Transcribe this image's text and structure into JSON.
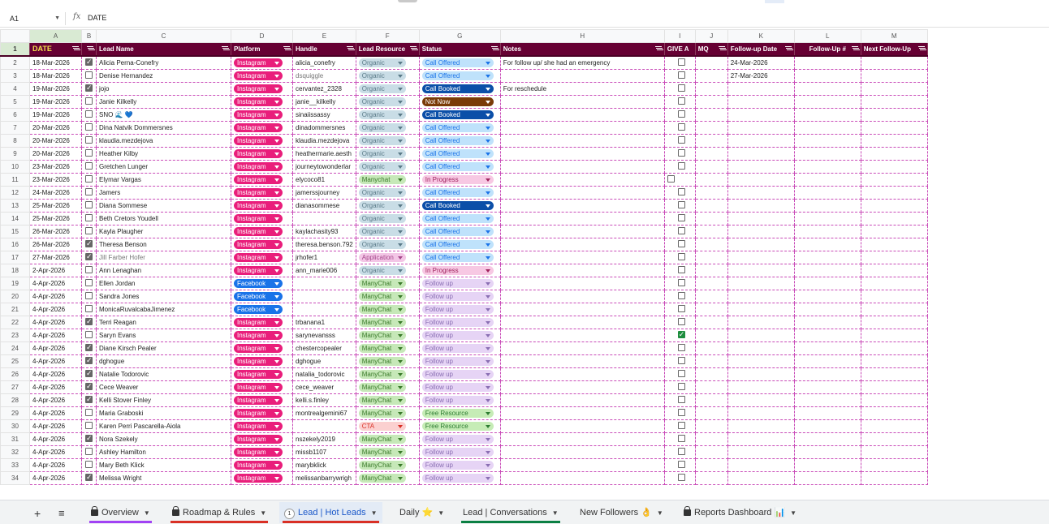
{
  "formula_bar": {
    "cell_ref": "A1",
    "fx": "fx",
    "value": "DATE"
  },
  "columns": [
    "A",
    "B",
    "C",
    "D",
    "E",
    "F",
    "G",
    "H",
    "I",
    "J",
    "K",
    "L",
    "M"
  ],
  "headers": {
    "date": "DATE",
    "lead_name": "Lead Name",
    "platform": "Platform",
    "handle": "Handle",
    "lead_resource": "Lead Resource",
    "status": "Status",
    "notes": "Notes",
    "give": "GIVE A",
    "mq": "MQ",
    "followup_date": "Follow-up Date",
    "followup_num": "Follow-Up #",
    "next_followup": "Next Follow-Up"
  },
  "rows": [
    {
      "n": "2",
      "date": "18-Mar-2026",
      "cb": true,
      "name": "Alicia Perna-Conefry",
      "platform": "Instagram",
      "handle": "alicia_conefry",
      "res": "Organic",
      "status": "Call Offered",
      "notes": "For follow up/ she had an emergency",
      "give": "off",
      "fdate": "24-Mar-2026"
    },
    {
      "n": "3",
      "date": "18-Mar-2026",
      "cb": false,
      "name": "Denise Hernandez",
      "platform": "Instagram",
      "handle": "dsquiggle",
      "res": "Organic",
      "status": "Call Offered",
      "notes": "",
      "give": "off",
      "fdate": "27-Mar-2026"
    },
    {
      "n": "4",
      "date": "19-Mar-2026",
      "cb": true,
      "name": "jojo",
      "platform": "Instagram",
      "handle": "cervantez_2328",
      "res": "Organic",
      "status": "Call Booked",
      "notes": "For reschedule",
      "give": "off",
      "fdate": ""
    },
    {
      "n": "5",
      "date": "19-Mar-2026",
      "cb": false,
      "name": "Janie Kilkelly",
      "platform": "Instagram",
      "handle": "janie__kilkelly",
      "res": "Organic",
      "status": "Not Now",
      "notes": "",
      "give": "off",
      "fdate": ""
    },
    {
      "n": "6",
      "date": "19-Mar-2026",
      "cb": false,
      "name": "SNO 🌊 💙",
      "platform": "Instagram",
      "handle": "sinaiissassy",
      "res": "Organic",
      "status": "Call Booked",
      "notes": "",
      "give": "off",
      "fdate": ""
    },
    {
      "n": "7",
      "date": "20-Mar-2026",
      "cb": false,
      "name": "Dina Natvik Dommersnes",
      "platform": "Instagram",
      "handle": "dinadommersnes",
      "res": "Organic",
      "status": "Call Offered",
      "notes": "",
      "give": "off",
      "fdate": ""
    },
    {
      "n": "8",
      "date": "20-Mar-2026",
      "cb": false,
      "name": "klaudia.mezdejova",
      "platform": "Instagram",
      "handle": "klaudia.mezdejova",
      "res": "Organic",
      "status": "Call Offered",
      "notes": "",
      "give": "off",
      "fdate": ""
    },
    {
      "n": "9",
      "date": "20-Mar-2026",
      "cb": false,
      "name": "Heather Kilby",
      "platform": "Instagram",
      "handle": "heathermarie.aesth",
      "res": "Organic",
      "status": "Call Offered",
      "notes": "",
      "give": "off",
      "fdate": ""
    },
    {
      "n": "10",
      "date": "23-Mar-2026",
      "cb": false,
      "name": "Gretchen Lunger",
      "platform": "Instagram",
      "handle": "journeytowonderlar",
      "res": "Organic",
      "status": "Call Offered",
      "notes": "",
      "give": "off",
      "fdate": ""
    },
    {
      "n": "11",
      "date": "23-Mar-2026",
      "cb": false,
      "name": "Elymar Vargas",
      "platform": "Instagram",
      "handle": "elycoco81",
      "res": "Manychat",
      "status": "In Progress",
      "notes": "",
      "give": "offleft",
      "fdate": ""
    },
    {
      "n": "12",
      "date": "24-Mar-2026",
      "cb": false,
      "name": "Jamers",
      "platform": "Instagram",
      "handle": "jamerssjourney",
      "res": "Organic",
      "status": "Call Offered",
      "notes": "",
      "give": "off",
      "fdate": ""
    },
    {
      "n": "13",
      "date": "25-Mar-2026",
      "cb": false,
      "name": "Diana Sommese",
      "platform": "Instagram",
      "handle": "dianasommese",
      "res": "Organic",
      "status": "Call Booked",
      "notes": "",
      "give": "off",
      "fdate": ""
    },
    {
      "n": "14",
      "date": "25-Mar-2026",
      "cb": false,
      "name": "Beth Cretors Youdell",
      "platform": "Instagram",
      "handle": "",
      "res": "Organic",
      "status": "Call Offered",
      "notes": "",
      "give": "off",
      "fdate": ""
    },
    {
      "n": "15",
      "date": "26-Mar-2026",
      "cb": false,
      "name": "Kayla Plaugher",
      "platform": "Instagram",
      "handle": "kaylachasity93",
      "res": "Organic",
      "status": "Call Offered",
      "notes": "",
      "give": "off",
      "fdate": ""
    },
    {
      "n": "16",
      "date": "26-Mar-2026",
      "cb": true,
      "name": "Theresa Benson",
      "platform": "Instagram",
      "handle": "theresa.benson.792",
      "res": "Organic",
      "status": "Call Offered",
      "notes": "",
      "give": "off",
      "fdate": ""
    },
    {
      "n": "17",
      "date": "27-Mar-2026",
      "cb": true,
      "name": "Jill Farber Hofer",
      "platform": "Instagram",
      "handle": "jrhofer1",
      "res": "Application",
      "status": "Call Offered",
      "notes": "",
      "give": "off",
      "fdate": ""
    },
    {
      "n": "18",
      "date": "2-Apr-2026",
      "cb": false,
      "name": "Ann Lenaghan",
      "platform": "Instagram",
      "handle": "ann_marie006",
      "res": "Organic",
      "status": "In Progress",
      "notes": "",
      "give": "off",
      "fdate": ""
    },
    {
      "n": "19",
      "date": "4-Apr-2026",
      "cb": false,
      "name": "Ellen Jordan",
      "platform": "Facebook",
      "handle": "",
      "res": "ManyChat",
      "status": "Follow up",
      "notes": "",
      "give": "off",
      "fdate": ""
    },
    {
      "n": "20",
      "date": "4-Apr-2026",
      "cb": false,
      "name": "Sandra Jones",
      "platform": "Facebook",
      "handle": "",
      "res": "ManyChat",
      "status": "Follow up",
      "notes": "",
      "give": "off",
      "fdate": ""
    },
    {
      "n": "21",
      "date": "4-Apr-2026",
      "cb": false,
      "name": "MonicaRuvalcabaJimenez",
      "platform": "Facebook",
      "handle": "",
      "res": "ManyChat",
      "status": "Follow up",
      "notes": "",
      "give": "off",
      "fdate": ""
    },
    {
      "n": "22",
      "date": "4-Apr-2026",
      "cb": true,
      "name": "Terri Reagan",
      "platform": "Instagram",
      "handle": "trbanana1",
      "res": "ManyChat",
      "status": "Follow up",
      "notes": "",
      "give": "off",
      "fdate": ""
    },
    {
      "n": "23",
      "date": "4-Apr-2026",
      "cb": false,
      "name": "Saryn Evans",
      "platform": "Instagram",
      "handle": "sarynevansss",
      "res": "ManyChat",
      "status": "Follow up",
      "notes": "",
      "give": "on",
      "fdate": ""
    },
    {
      "n": "24",
      "date": "4-Apr-2026",
      "cb": true,
      "name": "Diane Kirsch Pealer",
      "platform": "Instagram",
      "handle": "chestercopealer",
      "res": "ManyChat",
      "status": "Follow up",
      "notes": "",
      "give": "off",
      "fdate": ""
    },
    {
      "n": "25",
      "date": "4-Apr-2026",
      "cb": true,
      "name": "dghogue",
      "platform": "Instagram",
      "handle": "dghogue",
      "res": "ManyChat",
      "status": "Follow up",
      "notes": "",
      "give": "off",
      "fdate": ""
    },
    {
      "n": "26",
      "date": "4-Apr-2026",
      "cb": true,
      "name": "Natalie Todorovic",
      "platform": "Instagram",
      "handle": "natalia_todorovic",
      "res": "ManyChat",
      "status": "Follow up",
      "notes": "",
      "give": "off",
      "fdate": ""
    },
    {
      "n": "27",
      "date": "4-Apr-2026",
      "cb": true,
      "name": "Cece Weaver",
      "platform": "Instagram",
      "handle": "cece_weaver",
      "res": "ManyChat",
      "status": "Follow up",
      "notes": "",
      "give": "off",
      "fdate": ""
    },
    {
      "n": "28",
      "date": "4-Apr-2026",
      "cb": true,
      "name": "Kelli Stover Finley",
      "platform": "Instagram",
      "handle": "kelli.s.finley",
      "res": "ManyChat",
      "status": "Follow up",
      "notes": "",
      "give": "off",
      "fdate": ""
    },
    {
      "n": "29",
      "date": "4-Apr-2026",
      "cb": false,
      "name": "Maria Graboski",
      "platform": "Instagram",
      "handle": "montrealgemini67",
      "res": "ManyChat",
      "status": "Free Resource",
      "notes": "",
      "give": "off",
      "fdate": ""
    },
    {
      "n": "30",
      "date": "4-Apr-2026",
      "cb": false,
      "name": "Karen Perri Pascarella-Aiola",
      "platform": "Instagram",
      "handle": "",
      "res": "CTA",
      "status": "Free Resource",
      "notes": "",
      "give": "off",
      "fdate": ""
    },
    {
      "n": "31",
      "date": "4-Apr-2026",
      "cb": true,
      "name": "Nora Szekely",
      "platform": "Instagram",
      "handle": "nszekely2019",
      "res": "ManyChat",
      "status": "Follow up",
      "notes": "",
      "give": "off",
      "fdate": ""
    },
    {
      "n": "32",
      "date": "4-Apr-2026",
      "cb": false,
      "name": "Ashley Hamilton",
      "platform": "Instagram",
      "handle": "missb1107",
      "res": "ManyChat",
      "status": "Follow up",
      "notes": "",
      "give": "off",
      "fdate": ""
    },
    {
      "n": "33",
      "date": "4-Apr-2026",
      "cb": false,
      "name": "Mary Beth Klick",
      "platform": "Instagram",
      "handle": "marybklick",
      "res": "ManyChat",
      "status": "Follow up",
      "notes": "",
      "give": "off",
      "fdate": ""
    },
    {
      "n": "34",
      "date": "4-Apr-2026",
      "cb": true,
      "name": "Melissa Wright",
      "platform": "Instagram",
      "handle": "melissanbarrywrigh",
      "res": "ManyChat",
      "status": "Follow up",
      "notes": "",
      "give": "off",
      "fdate": ""
    }
  ],
  "tabs": [
    {
      "label": "Overview",
      "lock": true,
      "color": "#a142f4"
    },
    {
      "label": "Roadmap & Rules",
      "lock": true,
      "color": "#d93025"
    },
    {
      "label": "Lead | Hot Leads",
      "badge": "1",
      "active": true,
      "color": "#d93025"
    },
    {
      "label": "Daily ⭐",
      "color": ""
    },
    {
      "label": "Lead | Conversations",
      "color": "#0b8043"
    },
    {
      "label": "New Followers 👌",
      "color": ""
    },
    {
      "label": "Reports Dashboard 📊",
      "lock": true,
      "color": ""
    }
  ],
  "add_sheet_icon": "plus-icon",
  "all_sheets_icon": "menu-icon"
}
